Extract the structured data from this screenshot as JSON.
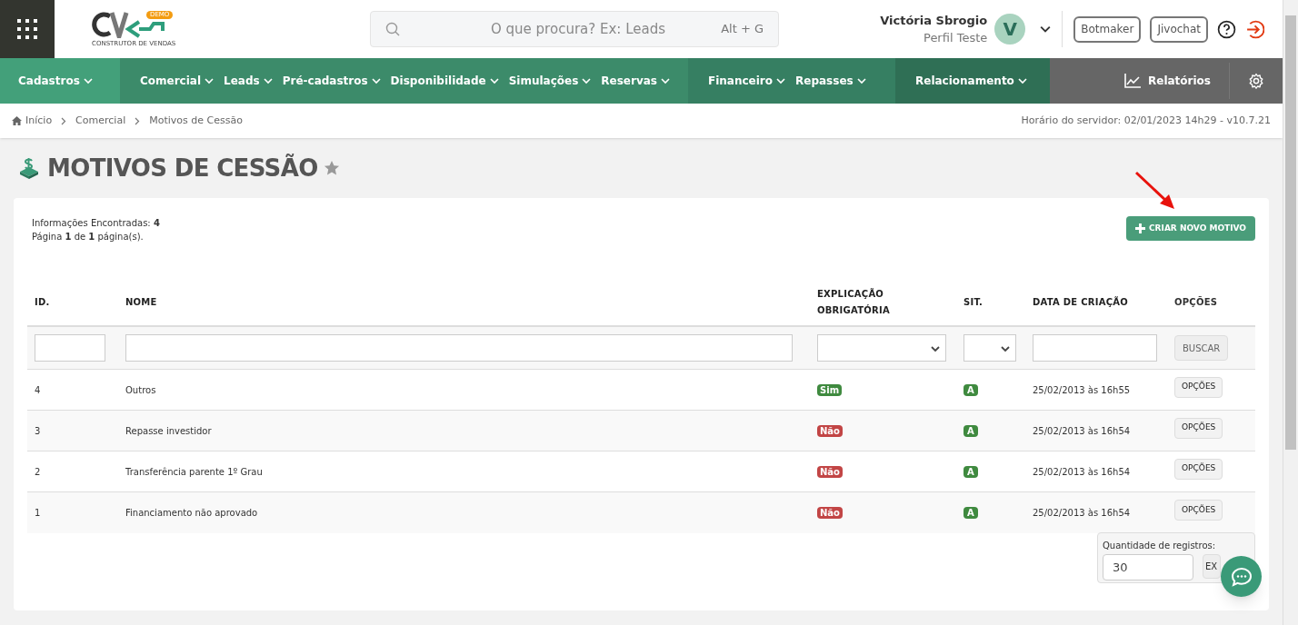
{
  "header": {
    "search": {
      "placeholder": "O que procura? Ex: Leads",
      "shortcut": "Alt + G"
    },
    "logo_badge": "DEMO",
    "logo_tagline": "CONSTRUTOR DE VENDAS",
    "user": {
      "name": "Victória Sbrogio",
      "profile": "Perfil Teste",
      "initial": "V"
    },
    "buttons": [
      "Botmaker",
      "Jivochat"
    ]
  },
  "nav": {
    "groups": [
      {
        "items": [
          "Cadastros"
        ]
      },
      {
        "items": [
          "Comercial",
          "Leads",
          "Pré-cadastros",
          "Disponibilidade",
          "Simulações",
          "Reservas"
        ]
      },
      {
        "items": [
          "Financeiro",
          "Repasses"
        ]
      },
      {
        "items": [
          "Relacionamento"
        ]
      }
    ],
    "reports": "Relatórios"
  },
  "breadcrumb": [
    "Início",
    "Comercial",
    "Motivos de Cessão"
  ],
  "server_time": "Horário do servidor: 02/01/2023 14h29 - v10.7.21",
  "page_title": "MOTIVOS DE CESSÃO",
  "summary": [
    "Informações Encontradas: **4**",
    "Página **1** de **1** página(s)."
  ],
  "create_button": "CRIAR NOVO MOTIVO",
  "table": {
    "columns": [
      "ID.",
      "NOME",
      "EXPLICAÇÃO OBRIGATÓRIA",
      "SIT.",
      "DATA DE CRIAÇÃO",
      "OPÇÕES"
    ],
    "search_button": "BUSCAR",
    "rows": [
      {
        "id": "4",
        "name": "Outros",
        "required": true,
        "explanation": "Sim",
        "status": "A",
        "created": "25/02/2013 às 16h55",
        "options": "OPÇÕES"
      },
      {
        "id": "3",
        "name": "Repasse investidor",
        "required": false,
        "explanation": "Não",
        "status": "A",
        "created": "25/02/2013 às 16h54",
        "options": "OPÇÕES"
      },
      {
        "id": "2",
        "name": "Transferência parente 1º Grau",
        "required": false,
        "explanation": "Não",
        "status": "A",
        "created": "25/02/2013 às 16h54",
        "options": "OPÇÕES"
      },
      {
        "id": "1",
        "name": "Financiamento não aprovado",
        "required": false,
        "explanation": "Não",
        "status": "A",
        "created": "25/02/2013 às 16h54",
        "options": "OPÇÕES"
      }
    ]
  },
  "records": {
    "label": "Quantidade de registros:",
    "value": "30",
    "button": "EX"
  }
}
